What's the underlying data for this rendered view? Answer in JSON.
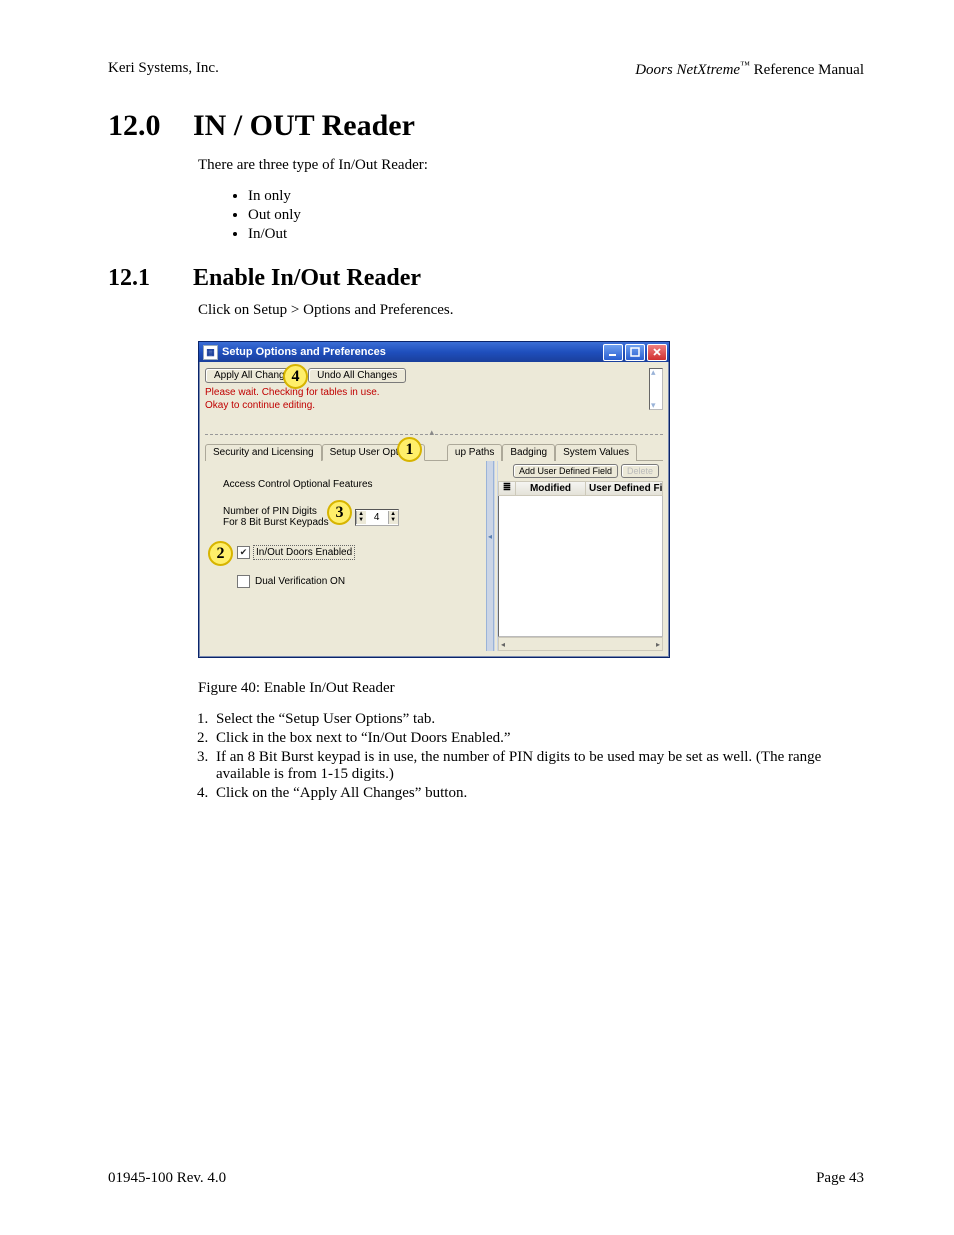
{
  "header": {
    "left": "Keri Systems, Inc.",
    "right_product": "Doors NetXtreme",
    "right_suffix": " Reference Manual"
  },
  "section12": {
    "num": "12.0",
    "title": "IN / OUT Reader",
    "intro": "There are three type of In/Out Reader:",
    "bullets": [
      "In only",
      "Out only",
      "In/Out"
    ]
  },
  "section121": {
    "num": "12.1",
    "title": "Enable In/Out Reader",
    "click": "Click on Setup > Options and Preferences."
  },
  "window": {
    "title": "Setup Options and Preferences",
    "apply": "Apply All Changes",
    "undo": "Undo All Changes",
    "status1": "Please wait.  Checking for tables in use.",
    "status2": "Okay to continue editing.",
    "tabs": {
      "t1": "Security and Licensing",
      "t2": "Setup User Options",
      "t3": "up Paths",
      "t4": "Badging",
      "t5": "System Values"
    },
    "leftpane": {
      "features": "Access Control Optional Features",
      "pin_l1": "Number of PIN Digits",
      "pin_l2": "For 8 Bit Burst Keypads",
      "pin_val": "4",
      "inout": "In/Out Doors Enabled",
      "dual": "Dual Verification ON"
    },
    "rightpane": {
      "add": "Add User Defined Field",
      "del": "Delete",
      "col2": "Modified",
      "col3": "User Defined Fi"
    },
    "callouts": {
      "c1": "1",
      "c2": "2",
      "c3": "3",
      "c4": "4"
    }
  },
  "figure_caption": "Figure 40: Enable In/Out Reader",
  "steps": [
    "Select the “Setup User Options” tab.",
    "Click in the box next to “In/Out Doors Enabled.”",
    "If an 8 Bit Burst keypad is in use, the number of PIN digits to be used may be set as well. (The range available is from 1-15 digits.)",
    "Click on the “Apply All Changes” button."
  ],
  "footer": {
    "left": "01945-100  Rev. 4.0",
    "right": "Page 43"
  }
}
